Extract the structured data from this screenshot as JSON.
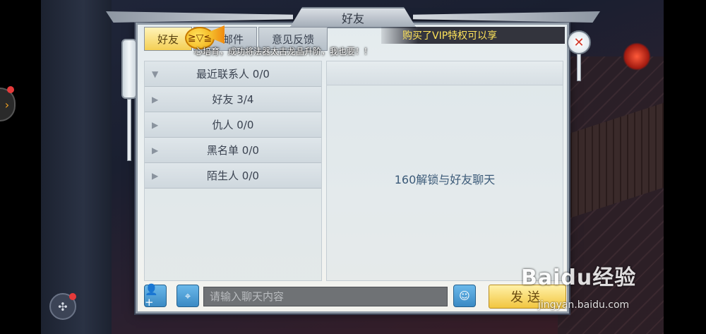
{
  "dialog": {
    "title": "好友",
    "tabs": [
      {
        "label": "好友",
        "active": true
      },
      {
        "label": "邮件",
        "active": false
      },
      {
        "label": "意见反馈",
        "active": false
      }
    ],
    "announcement_vip": "购买了VIP特权可以享",
    "announcement_scroll": "心培育，成功将法器太古龙晶升阶，我也要！！",
    "close_icon": "close-icon"
  },
  "friend_groups": [
    {
      "label": "最近联系人 0/0",
      "expanded": true
    },
    {
      "label": "好友 3/4",
      "expanded": false
    },
    {
      "label": "仇人 0/0",
      "expanded": false
    },
    {
      "label": "黑名单 0/0",
      "expanded": false
    },
    {
      "label": "陌生人 0/0",
      "expanded": false
    }
  ],
  "chat": {
    "lock_message": "160解锁与好友聊天",
    "input_placeholder": "请输入聊天内容",
    "send_label": "发送"
  },
  "bottom_icons": {
    "add_friend": "add-friend-icon",
    "location": "location-icon",
    "emoji": "emoji-icon"
  },
  "watermark": {
    "logo": "Baidu经验",
    "url": "jingyan.baidu.com"
  },
  "colors": {
    "accent_gold": "#f4cf54",
    "vip_text": "#ffe45a",
    "action_blue": "#3a8ac4",
    "lock_text": "#3b5a78",
    "alert_red": "#e53a3a"
  }
}
